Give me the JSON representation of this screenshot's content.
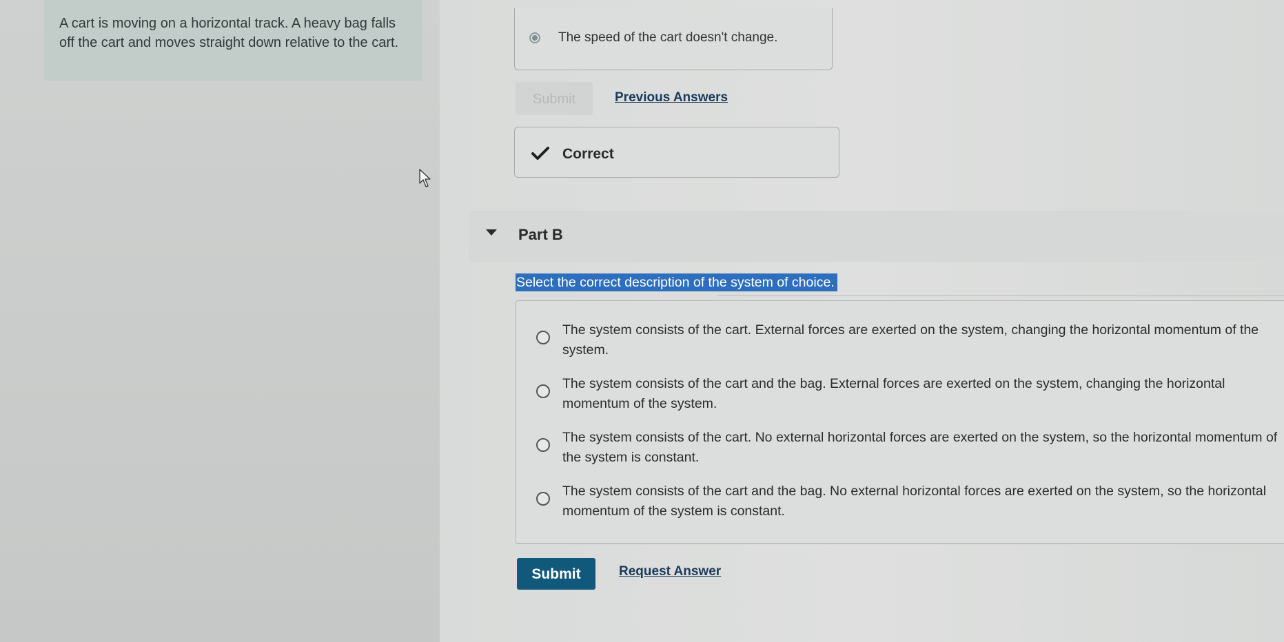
{
  "problem": {
    "text": "A cart is moving on a horizontal track. A heavy bag falls off the cart and moves straight down relative to the cart."
  },
  "part_a": {
    "selected_answer": "The speed of the cart doesn't change.",
    "submit_label": "Submit",
    "previous_answers_label": "Previous Answers",
    "feedback": "Correct"
  },
  "part_b": {
    "title": "Part B",
    "instruction": "Select the correct description of the system of choice.",
    "choices": [
      {
        "text": "The system consists of the cart. External forces are exerted on the system, changing the horizontal momentum of the system."
      },
      {
        "text": "The system consists of the cart and the bag. External forces are exerted on the system, changing the horizontal momentum of the system."
      },
      {
        "text": "The system consists of the cart. No external horizontal forces are exerted on the system, so the horizontal momentum of the system is constant."
      },
      {
        "text": "The system consists of the cart and the bag. No external horizontal forces are exerted on the system, so the horizontal momentum of the system is constant."
      }
    ],
    "submit_label": "Submit",
    "request_answer_label": "Request Answer"
  },
  "colors": {
    "submit_active": "#10597a",
    "instruction_highlight": "#2e6fbd",
    "link": "#1c3a5c",
    "check": "#2a2a2a"
  }
}
